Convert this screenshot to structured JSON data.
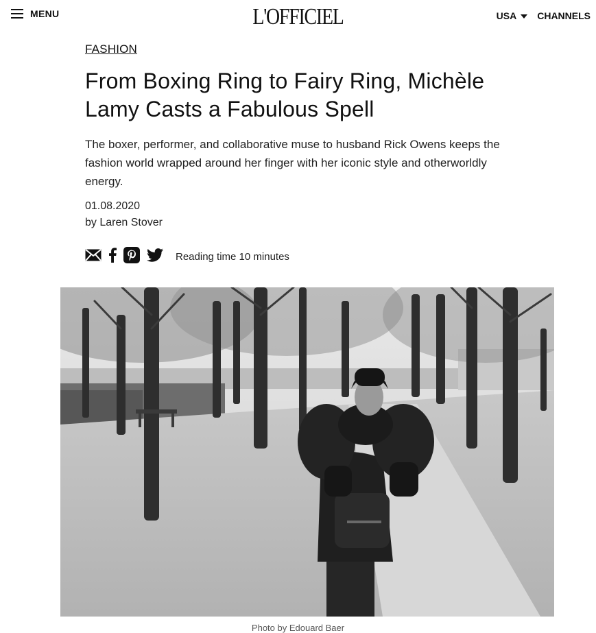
{
  "header": {
    "menu_label": "MENU",
    "logo_text": "L'OFFICIEL",
    "region_label": "USA",
    "channels_label": "CHANNELS"
  },
  "article": {
    "category": "FASHION",
    "title": "From Boxing Ring to Fairy Ring, Michèle Lamy Casts a Fabulous Spell",
    "dek": "The boxer, performer, and collaborative muse to husband Rick Owens keeps the fashion world wrapped around her finger with her iconic style and otherworldly energy.",
    "date": "01.08.2020",
    "byline": "by Laren Stover",
    "reading_time": "Reading time 10 minutes",
    "share_icons": [
      "email-icon",
      "facebook-icon",
      "pinterest-icon",
      "twitter-icon"
    ]
  },
  "hero": {
    "description": "Black-and-white photo of a woman in a puffy sleeve jacket walking along a tree-lined gravel path in a park",
    "caption": "Photo by Edouard Baer"
  },
  "colors": {
    "text": "#111111",
    "muted": "#555555",
    "background": "#ffffff"
  }
}
